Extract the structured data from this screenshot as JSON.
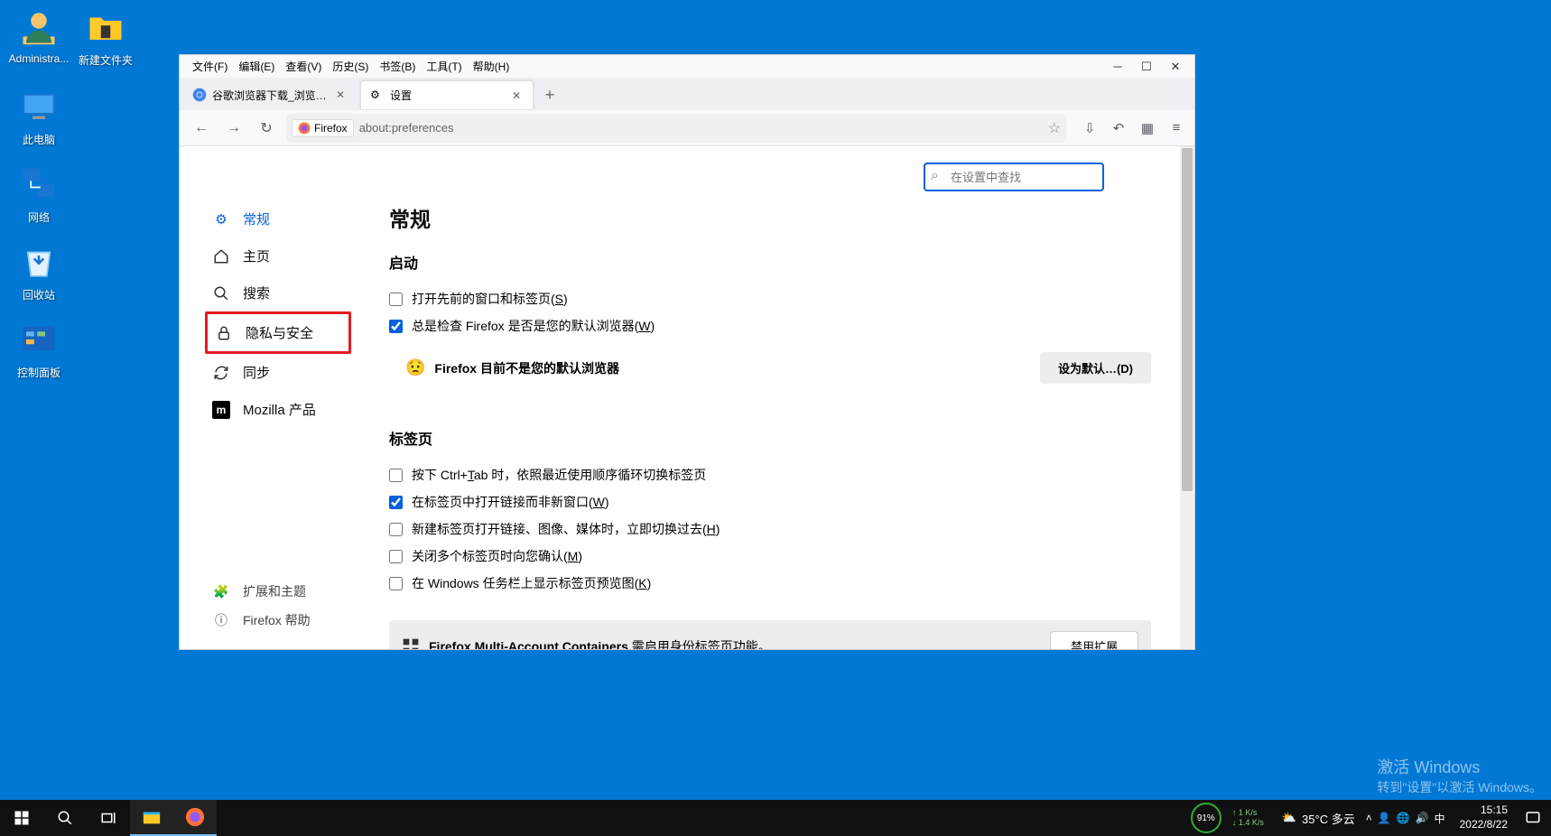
{
  "desktop": {
    "icons": [
      {
        "name": "Administra...",
        "icon": "user"
      },
      {
        "name": "新建文件夹",
        "icon": "folder"
      },
      {
        "name": "此电脑",
        "icon": "pc"
      },
      {
        "name": "网络",
        "icon": "network"
      },
      {
        "name": "回收站",
        "icon": "recycle"
      },
      {
        "name": "控制面板",
        "icon": "control"
      }
    ]
  },
  "firefox": {
    "menubar": [
      "文件(F)",
      "编辑(E)",
      "查看(V)",
      "历史(S)",
      "书签(B)",
      "工具(T)",
      "帮助(H)"
    ],
    "tabs": [
      {
        "title": "谷歌浏览器下载_浏览器官网入口",
        "active": false,
        "icon": "chrome"
      },
      {
        "title": "设置",
        "active": true,
        "icon": "gear"
      }
    ],
    "urlbar": {
      "badge": "Firefox",
      "url": "about:preferences"
    },
    "sidebar": {
      "items": [
        {
          "icon": "gear",
          "label": "常规",
          "active": true
        },
        {
          "icon": "home",
          "label": "主页"
        },
        {
          "icon": "search",
          "label": "搜索"
        },
        {
          "icon": "lock",
          "label": "隐私与安全",
          "highlighted": true
        },
        {
          "icon": "sync",
          "label": "同步"
        },
        {
          "icon": "moz",
          "label": "Mozilla 产品"
        }
      ],
      "footer": [
        {
          "icon": "puzzle",
          "label": "扩展和主题"
        },
        {
          "icon": "help",
          "label": "Firefox 帮助"
        }
      ]
    },
    "settings": {
      "search_placeholder": "在设置中查找",
      "title": "常规",
      "startup": {
        "heading": "启动",
        "opt_restore": {
          "label": "打开先前的窗口和标签页(",
          "key": "S",
          "tail": ")",
          "checked": false
        },
        "opt_check_default": {
          "label": "总是检查 Firefox 是否是您的默认浏览器(",
          "key": "W",
          "tail": ")",
          "checked": true
        },
        "default_status": "Firefox 目前不是您的默认浏览器",
        "default_btn": "设为默认…(D)"
      },
      "tabs": {
        "heading": "标签页",
        "opts": [
          {
            "pre": "按下 Ctrl+",
            "key": "T",
            "post": "ab 时，依照最近使用顺序循环切换标签页",
            "checked": false
          },
          {
            "pre": "在标签页中打开链接而非新窗口(",
            "key": "W",
            "post": ")",
            "checked": true
          },
          {
            "pre": "新建标签页打开链接、图像、媒体时，立即切换过去(",
            "key": "H",
            "post": ")",
            "checked": false
          },
          {
            "pre": "关闭多个标签页时向您确认(",
            "key": "M",
            "post": ")",
            "checked": false
          },
          {
            "pre": "在 Windows 任务栏上显示标签页预览图(",
            "key": "K",
            "post": ")",
            "checked": false
          }
        ],
        "ext_bold": "Firefox Multi-Account Containers",
        "ext_text": " 需启用身份标签页功能。",
        "ext_btn": "禁用扩展"
      }
    }
  },
  "taskbar": {
    "weather": "35°C 多云",
    "battery": "91%",
    "net_up": "1 K/s",
    "net_down": "1.4 K/s",
    "ime": "中",
    "time": "15:15",
    "date": "2022/8/22"
  },
  "watermark": {
    "line1": "激活 Windows",
    "line2": "转到\"设置\"以激活 Windows。"
  }
}
